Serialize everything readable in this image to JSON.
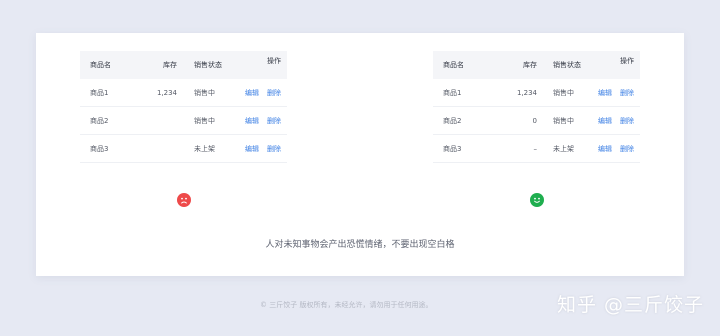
{
  "left_table": {
    "headers": {
      "name": "商品名",
      "stock": "库存",
      "status": "销售状态",
      "op": "操作"
    },
    "rows": [
      {
        "name": "商品1",
        "stock": "1,234",
        "status": "销售中",
        "edit": "编辑",
        "del": "删除"
      },
      {
        "name": "商品2",
        "stock": "",
        "status": "销售中",
        "edit": "编辑",
        "del": "删除"
      },
      {
        "name": "商品3",
        "stock": "",
        "status": "未上架",
        "edit": "编辑",
        "del": "删除"
      }
    ]
  },
  "right_table": {
    "headers": {
      "name": "商品名",
      "stock": "库存",
      "status": "销售状态",
      "op": "操作"
    },
    "rows": [
      {
        "name": "商品1",
        "stock": "1,234",
        "status": "销售中",
        "edit": "编辑",
        "del": "删除"
      },
      {
        "name": "商品2",
        "stock": "0",
        "status": "销售中",
        "edit": "编辑",
        "del": "删除"
      },
      {
        "name": "商品3",
        "stock": "–",
        "status": "未上架",
        "edit": "编辑",
        "del": "删除"
      }
    ]
  },
  "indicators": {
    "left": "sad-face-icon",
    "right": "happy-face-icon",
    "left_color": "#ee4a4a",
    "right_color": "#1fae4f"
  },
  "caption": "人对未知事物会产出恐慌情绪，不要出现空白格",
  "footer": "© 三斤饺子  版权所有，未经允许，请勿用于任何用途。",
  "watermark": "知乎 @三斤饺子"
}
